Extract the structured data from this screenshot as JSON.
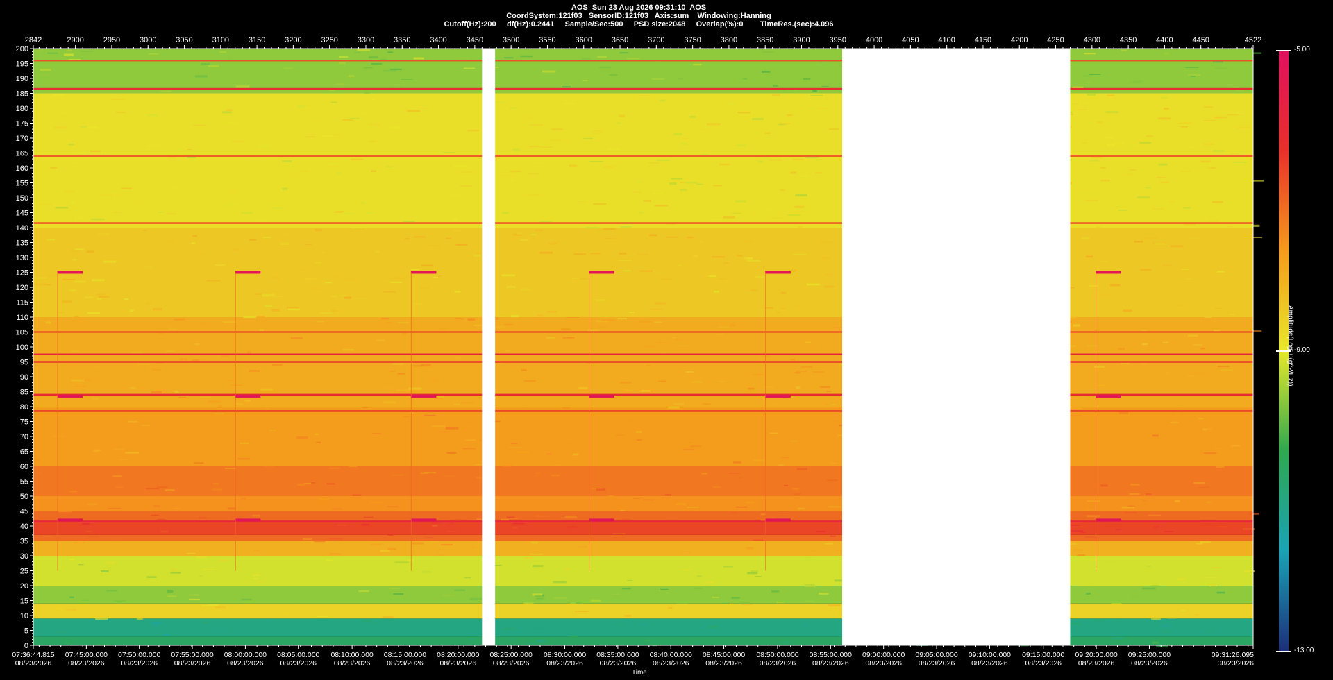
{
  "header": {
    "title": "AOS  Sun 23 Aug 2026 09:31:10  AOS",
    "line2": "CoordSystem:121f03   SensorID:121f03   Axis:sum    Windowing:Hanning",
    "line3": "Cutoff(Hz):200     df(Hz):0.2441     Sample/Sec:500     PSD size:2048     Overlap(%):0        TimeRes.(sec):4.096"
  },
  "chart_data": {
    "type": "heatmap",
    "title": "AOS  Sun 23 Aug 2026 09:31:10  AOS",
    "xlabel": "Time",
    "ylabel": "",
    "top_axis": {
      "range": [
        2842,
        4522
      ],
      "ticks": [
        2842,
        2900,
        2950,
        3000,
        3050,
        3100,
        3150,
        3200,
        3250,
        3300,
        3350,
        3400,
        3450,
        3500,
        3550,
        3600,
        3650,
        3700,
        3750,
        3800,
        3850,
        3900,
        3950,
        4000,
        4050,
        4100,
        4150,
        4200,
        4250,
        4300,
        4350,
        4400,
        4450,
        4522
      ]
    },
    "y_axis": {
      "range": [
        0,
        200
      ],
      "ticks": [
        0,
        5,
        10,
        15,
        20,
        25,
        30,
        35,
        40,
        45,
        50,
        55,
        60,
        65,
        70,
        75,
        80,
        85,
        90,
        95,
        100,
        105,
        110,
        115,
        120,
        125,
        130,
        135,
        140,
        145,
        150,
        155,
        160,
        165,
        170,
        175,
        180,
        185,
        190,
        195,
        200
      ]
    },
    "bottom_axis": {
      "ticks": [
        {
          "time": "07:36:44.815",
          "date": "08/23/2026",
          "n": 2842
        },
        {
          "time": "07:45:00.000",
          "date": "08/23/2026",
          "n": 2915
        },
        {
          "time": "07:50:00.000",
          "date": "08/23/2026",
          "n": 2988
        },
        {
          "time": "07:55:00.000",
          "date": "08/23/2026",
          "n": 3061
        },
        {
          "time": "08:00:00.000",
          "date": "08/23/2026",
          "n": 3134
        },
        {
          "time": "08:05:00.000",
          "date": "08/23/2026",
          "n": 3207
        },
        {
          "time": "08:10:00.000",
          "date": "08/23/2026",
          "n": 3281
        },
        {
          "time": "08:15:00.000",
          "date": "08/23/2026",
          "n": 3354
        },
        {
          "time": "08:20:00.000",
          "date": "08/23/2026",
          "n": 3427
        },
        {
          "time": "08:25:00.000",
          "date": "08/23/2026",
          "n": 3500
        },
        {
          "time": "08:30:00.000",
          "date": "08/23/2026",
          "n": 3574
        },
        {
          "time": "08:35:00.000",
          "date": "08/23/2026",
          "n": 3647
        },
        {
          "time": "08:40:00.000",
          "date": "08/23/2026",
          "n": 3720
        },
        {
          "time": "08:45:00.000",
          "date": "08/23/2026",
          "n": 3793
        },
        {
          "time": "08:50:00.000",
          "date": "08/23/2026",
          "n": 3867
        },
        {
          "time": "08:55:00.000",
          "date": "08/23/2026",
          "n": 3940
        },
        {
          "time": "09:00:00.000",
          "date": "08/23/2026",
          "n": 4013
        },
        {
          "time": "09:05:00.000",
          "date": "08/23/2026",
          "n": 4086
        },
        {
          "time": "09:10:00.000",
          "date": "08/23/2026",
          "n": 4159
        },
        {
          "time": "09:15:00.000",
          "date": "08/23/2026",
          "n": 4233
        },
        {
          "time": "09:20:00.000",
          "date": "08/23/2026",
          "n": 4306
        },
        {
          "time": "09:25:00.000",
          "date": "08/23/2026",
          "n": 4379
        },
        {
          "time": "09:31:26.095",
          "date": "08/23/2026",
          "n": 4522
        }
      ]
    },
    "gaps": [
      [
        3460,
        3478
      ],
      [
        3956,
        4270
      ]
    ],
    "colorbar": {
      "label": "Amplitude(Log10(g^2/Hz))",
      "ticks": [
        "-5.00",
        "-9.00",
        "-13.00"
      ],
      "range": [
        -13,
        -5
      ],
      "colors": [
        "#1c2f7a",
        "#1aa3b5",
        "#2fa84f",
        "#e8e82a",
        "#f59a1c",
        "#e8302a",
        "#e0105f"
      ]
    },
    "bands": [
      {
        "lo": 0,
        "hi": 3,
        "level": 0.3
      },
      {
        "lo": 3,
        "hi": 9,
        "level": 0.25
      },
      {
        "lo": 9,
        "hi": 14,
        "level": 0.55
      },
      {
        "lo": 14,
        "hi": 20,
        "level": 0.42
      },
      {
        "lo": 20,
        "hi": 30,
        "level": 0.48
      },
      {
        "lo": 30,
        "hi": 35,
        "level": 0.62
      },
      {
        "lo": 35,
        "hi": 37,
        "level": 0.74
      },
      {
        "lo": 37,
        "hi": 42,
        "level": 0.8
      },
      {
        "lo": 42,
        "hi": 45,
        "level": 0.74
      },
      {
        "lo": 45,
        "hi": 50,
        "level": 0.68
      },
      {
        "lo": 50,
        "hi": 60,
        "level": 0.72
      },
      {
        "lo": 60,
        "hi": 80,
        "level": 0.66
      },
      {
        "lo": 80,
        "hi": 110,
        "level": 0.63
      },
      {
        "lo": 110,
        "hi": 140,
        "level": 0.57
      },
      {
        "lo": 140,
        "hi": 185,
        "level": 0.52
      },
      {
        "lo": 185,
        "hi": 200,
        "level": 0.42
      }
    ],
    "lines": [
      {
        "f": 41.5,
        "level": 0.88
      },
      {
        "f": 78.5,
        "level": 0.85
      },
      {
        "f": 84,
        "level": 0.86
      },
      {
        "f": 95,
        "level": 0.84
      },
      {
        "f": 97.5,
        "level": 0.9
      },
      {
        "f": 105,
        "level": 0.78
      },
      {
        "f": 141.5,
        "level": 0.8
      },
      {
        "f": 164,
        "level": 0.76
      },
      {
        "f": 186.5,
        "level": 0.85
      },
      {
        "f": 196,
        "level": 0.78
      }
    ],
    "events": [
      2875,
      3120,
      3362,
      3607,
      3850,
      4305
    ]
  }
}
